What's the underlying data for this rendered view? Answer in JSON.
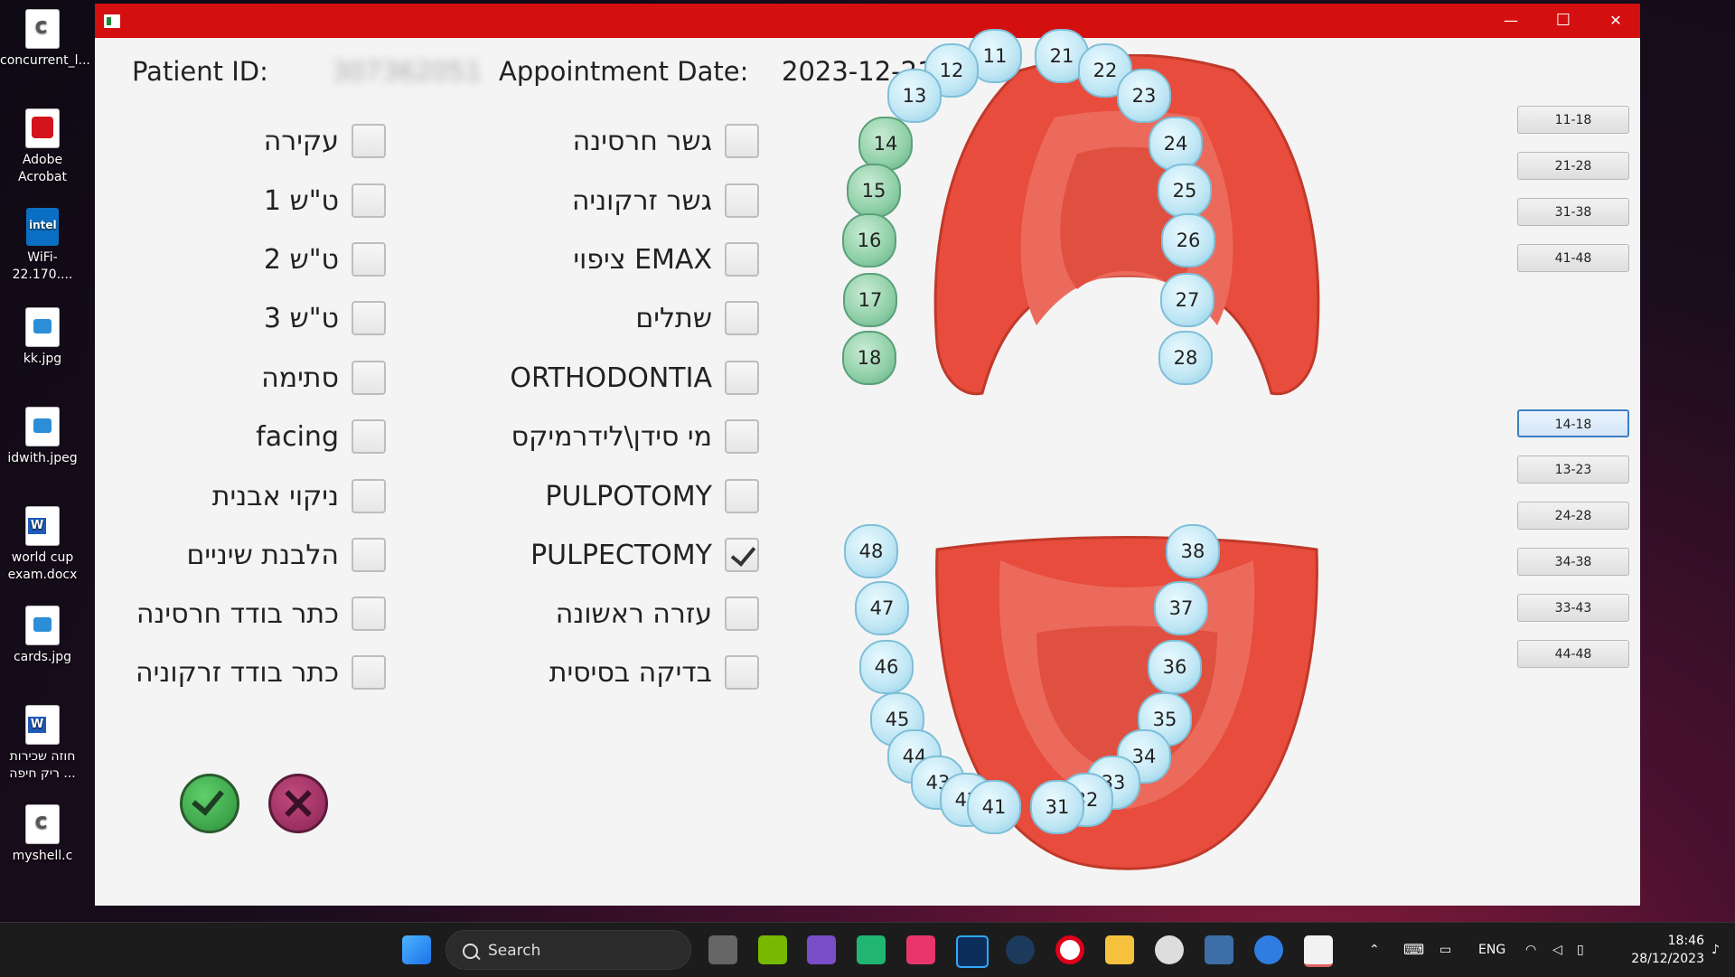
{
  "desktop_icons": [
    {
      "label": "concurrent_l...",
      "icon": "c-source-file-icon"
    },
    {
      "label": "Adobe\nAcrobat",
      "icon": "acrobat-icon"
    },
    {
      "label": "WiFi-22.170....",
      "icon": "intel-wifi-icon"
    },
    {
      "label": "kk.jpg",
      "icon": "image-file-icon"
    },
    {
      "label": "idwith.jpeg",
      "icon": "image-file-icon"
    },
    {
      "label": "world cup exam.docx",
      "icon": "word-file-icon"
    },
    {
      "label": "cards.jpg",
      "icon": "image-file-icon"
    },
    {
      "label": "חוזה שכירות ריק חיפה ...",
      "icon": "word-file-icon"
    },
    {
      "label": "myshell.c",
      "icon": "c-source-file-icon"
    }
  ],
  "window": {
    "title_controls": {
      "minimize": "—",
      "maximize": "☐",
      "close": "✕"
    },
    "patient_id_label": "Patient ID:",
    "patient_id_value": "307362051",
    "date_label": "Appointment Date:",
    "date_value": "2023-12-21"
  },
  "treatments_right": [
    {
      "label": "עקירה",
      "checked": false
    },
    {
      "label": "ט\"ש 1",
      "checked": false
    },
    {
      "label": "ט\"ש 2",
      "checked": false
    },
    {
      "label": "ט\"ש 3",
      "checked": false
    },
    {
      "label": "סתימה",
      "checked": false
    },
    {
      "label": "facing",
      "checked": false
    },
    {
      "label": "ניקוי אבנית",
      "checked": false
    },
    {
      "label": "הלבנת שיניים",
      "checked": false
    },
    {
      "label": "כתר בודד חרסינה",
      "checked": false
    },
    {
      "label": "כתר בודד זרקוניה",
      "checked": false
    }
  ],
  "treatments_left": [
    {
      "label": "גשר חרסינה",
      "checked": false
    },
    {
      "label": "גשר זרקוניה",
      "checked": false
    },
    {
      "label": "ציפוי EMAX",
      "checked": false
    },
    {
      "label": "שתלים",
      "checked": false
    },
    {
      "label": "ORTHODONTIA",
      "checked": false
    },
    {
      "label": "מי סידן\\לידרמיקס",
      "checked": false
    },
    {
      "label": "PULPOTOMY",
      "checked": false
    },
    {
      "label": "PULPECTOMY",
      "checked": true
    },
    {
      "label": "עזרה ראשונה",
      "checked": false
    },
    {
      "label": "בדיקה בסיסית",
      "checked": false
    }
  ],
  "actions": {
    "confirm": "confirm-check-icon",
    "cancel": "cancel-x-icon"
  },
  "quadrant_buttons": [
    "11-18",
    "21-28",
    "31-38",
    "41-48"
  ],
  "segment_buttons": [
    {
      "label": "14-18",
      "selected": true
    },
    {
      "label": "13-23",
      "selected": false
    },
    {
      "label": "24-28",
      "selected": false
    },
    {
      "label": "34-38",
      "selected": false
    },
    {
      "label": "33-43",
      "selected": false
    },
    {
      "label": "44-48",
      "selected": false
    }
  ],
  "upper_teeth": [
    {
      "n": "11",
      "selected": false
    },
    {
      "n": "21",
      "selected": false
    },
    {
      "n": "12",
      "selected": false
    },
    {
      "n": "22",
      "selected": false
    },
    {
      "n": "13",
      "selected": false
    },
    {
      "n": "23",
      "selected": false
    },
    {
      "n": "14",
      "selected": true
    },
    {
      "n": "24",
      "selected": false
    },
    {
      "n": "15",
      "selected": true
    },
    {
      "n": "25",
      "selected": false
    },
    {
      "n": "16",
      "selected": true
    },
    {
      "n": "26",
      "selected": false
    },
    {
      "n": "17",
      "selected": true
    },
    {
      "n": "27",
      "selected": false
    },
    {
      "n": "18",
      "selected": true
    },
    {
      "n": "28",
      "selected": false
    }
  ],
  "lower_teeth": [
    {
      "n": "48",
      "selected": false
    },
    {
      "n": "38",
      "selected": false
    },
    {
      "n": "47",
      "selected": false
    },
    {
      "n": "37",
      "selected": false
    },
    {
      "n": "46",
      "selected": false
    },
    {
      "n": "36",
      "selected": false
    },
    {
      "n": "45",
      "selected": false
    },
    {
      "n": "35",
      "selected": false
    },
    {
      "n": "44",
      "selected": false
    },
    {
      "n": "34",
      "selected": false
    },
    {
      "n": "43",
      "selected": false
    },
    {
      "n": "33",
      "selected": false
    },
    {
      "n": "42",
      "selected": false
    },
    {
      "n": "32",
      "selected": false
    },
    {
      "n": "41",
      "selected": false
    },
    {
      "n": "31",
      "selected": false
    }
  ],
  "taskbar": {
    "search_text": "Search",
    "apps": [
      "task-view-icon",
      "nvidia-icon",
      "visual-studio-icon",
      "clion-icon",
      "intellij-icon",
      "photoshop-icon",
      "steam-icon",
      "opera-icon",
      "file-explorer-icon",
      "clock-app-icon",
      "resource-monitor-icon",
      "app-icon",
      "java-icon"
    ],
    "language": "ENG",
    "time": "18:46",
    "date": "28/12/2023"
  },
  "colors": {
    "titlebar": "#d30f0f",
    "selected_tooth": "#8fcfa7",
    "normal_tooth": "#bfe6f4",
    "gum": "#e74c3c"
  }
}
